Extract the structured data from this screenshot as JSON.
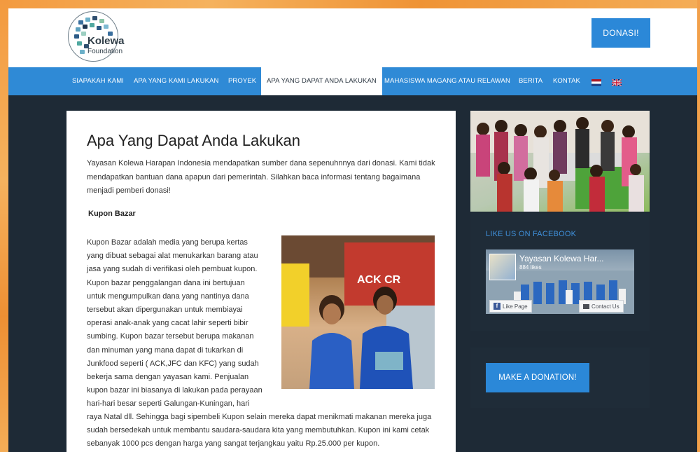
{
  "brand": {
    "logo_line1": "Kolewa",
    "logo_line2": "Foundation"
  },
  "header": {
    "donate_label": "DONASI!"
  },
  "nav": {
    "items": [
      {
        "label": "SIAPAKAH KAMI"
      },
      {
        "label": "APA YANG KAMI LAKUKAN"
      },
      {
        "label": "PROYEK"
      },
      {
        "label": "APA YANG DAPAT ANDA LAKUKAN"
      },
      {
        "label": "MAHASISWA MAGANG ATAU RELAWAN"
      },
      {
        "label": "BERITA"
      },
      {
        "label": "KONTAK"
      }
    ],
    "active_index": 3,
    "flags": [
      "dutch-flag-icon",
      "uk-flag-icon"
    ]
  },
  "main": {
    "title": "Apa Yang Dapat Anda Lakukan",
    "intro": "Yayasan Kolewa Harapan Indonesia mendapatkan sumber dana sepenuhnnya dari donasi. Kami tidak mendapatkan bantuan dana apapun dari pemerintah. Silahkan baca informasi tentang bagaimana menjadi pemberi donasi!",
    "section_heading": "Kupon Bazar",
    "body_narrow": "Kupon Bazar adalah media yang berupa kertas yang dibuat sebagai alat menukarkan barang atau jasa yang sudah di verifikasi oleh pembuat kupon. Kupon bazar penggalangan dana ini bertujuan untuk mengumpulkan dana yang nantinya dana tersebut akan dipergunakan untuk membiayai operasi anak-anak yang cacat lahir seperti bibir sumbing. Kupon bazar tersebut berupa makanan dan minuman yang mana dapat di tukarkan di Junkfood seperti ( ACK,JFC dan KFC) yang sudah bekerja sama dengan yayasan kami. Penjualan kupon bazar ini biasanya di lakukan pada perayaan hari-hari besar seperti Galungan-Kuningan, hari",
    "body_wide": "raya Natal dll. Sehingga bagi sipembeli Kupon selain mereka  dapat menikmati makanan mereka juga sudah bersedekah untuk membantu saudara-saudara kita yang membutuhkan. Kupon ini kami cetak sebanyak 1000 pcs dengan harga yang sangat terjangkau yaitu Rp.25.000 per kupon.",
    "photo_sign": "ACK CR"
  },
  "sidebar": {
    "facebook_heading": "LIKE US ON FACEBOOK",
    "fb_page_name": "Yayasan Kolewa Har...",
    "fb_likes": "884 likes",
    "fb_like_button": "Like Page",
    "fb_contact_button": "Contact Us",
    "donation_button": "MAKE A DONATION!"
  },
  "colors": {
    "accent_blue": "#2b88d8",
    "nav_blue": "#2f8ad6",
    "dark_bg": "#1e2a36",
    "frame_orange": "#f0a24a"
  }
}
